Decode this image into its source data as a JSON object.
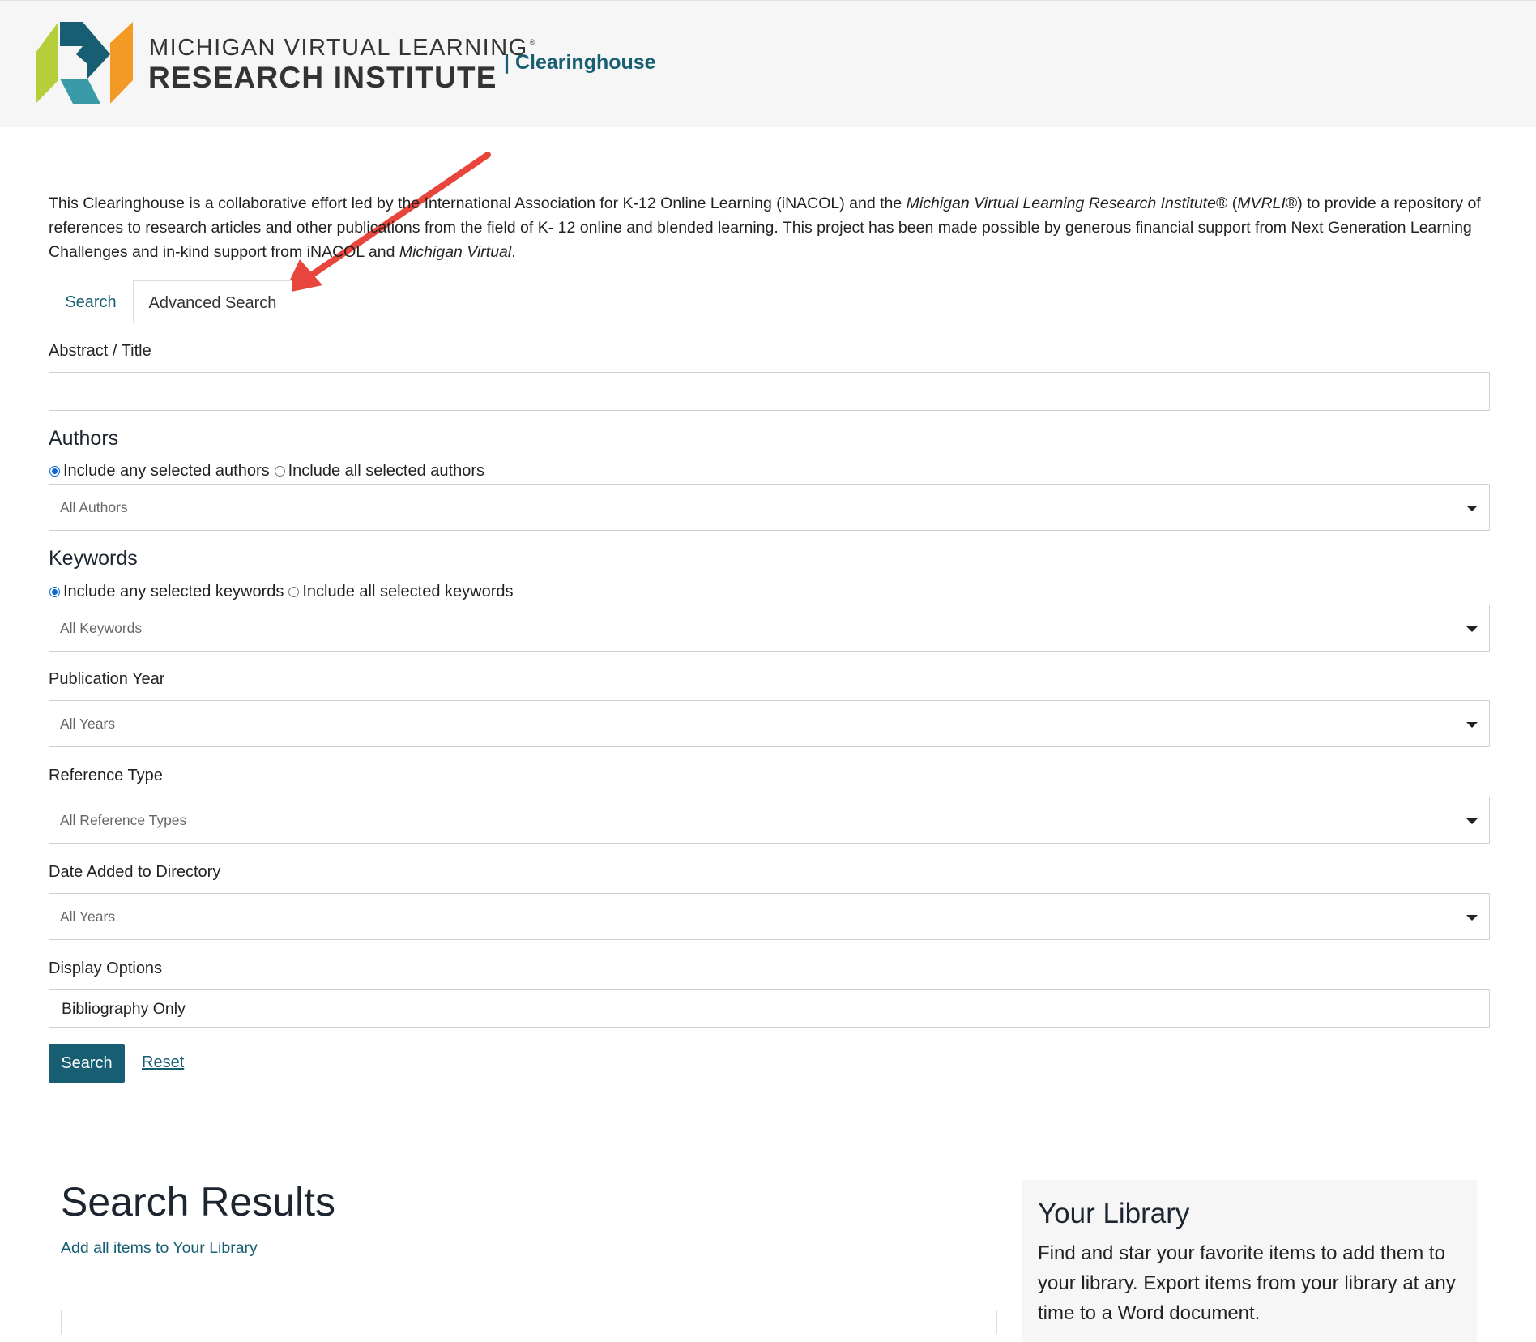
{
  "header": {
    "brand_line1": "MICHIGAN VIRTUAL LEARNING",
    "brand_mark": "®",
    "brand_line2": "RESEARCH INSTITUTE",
    "brand_sub": "| Clearinghouse",
    "logo_icon": "mvlri-logo-icon",
    "colors": {
      "lime": "#b5cf3a",
      "teal_dark": "#175e72",
      "teal": "#3a9aa6",
      "orange": "#f39a25"
    }
  },
  "intro": {
    "p1": "This Clearinghouse is a collaborative effort led by the International Association for K-12 Online Learning (iNACOL) and the ",
    "org_italic": "Michigan Virtual Learning Research Institute",
    "p2": "® (",
    "abbr_italic": "MVRLI",
    "p3": "®) to provide a repository of references to research articles and other publications from the field of K- 12 online and blended learning. This project has been made possible by generous financial support from Next Generation Learning Challenges and in-kind support from iNACOL and ",
    "mv_italic": "Michigan Virtual",
    "p4": "."
  },
  "tabs": {
    "search": "Search",
    "advanced": "Advanced Search",
    "active": "advanced"
  },
  "form": {
    "abstract_label": "Abstract / Title",
    "abstract_value": "",
    "authors": {
      "heading": "Authors",
      "opt_any": "Include any selected authors",
      "opt_all": "Include all selected authors",
      "selected": "any",
      "placeholder": "All Authors"
    },
    "keywords": {
      "heading": "Keywords",
      "opt_any": "Include any selected keywords",
      "opt_all": "Include all selected keywords",
      "selected": "any",
      "placeholder": "All Keywords"
    },
    "pub_year": {
      "label": "Publication Year",
      "placeholder": "All Years"
    },
    "ref_type": {
      "label": "Reference Type",
      "placeholder": "All Reference Types"
    },
    "date_added": {
      "label": "Date Added to Directory",
      "placeholder": "All Years"
    },
    "display": {
      "label": "Display Options",
      "value": "Bibliography Only"
    },
    "search_label": "Search",
    "reset_label": "Reset"
  },
  "results": {
    "title": "Search Results",
    "add_all": "Add all items to Your Library"
  },
  "library": {
    "title": "Your Library",
    "text": "Find and star your favorite items to add them to your library. Export items from your library at any time to a Word document."
  },
  "annotation": {
    "arrow_icon": "red-arrow-icon",
    "color": "#e8453c"
  }
}
